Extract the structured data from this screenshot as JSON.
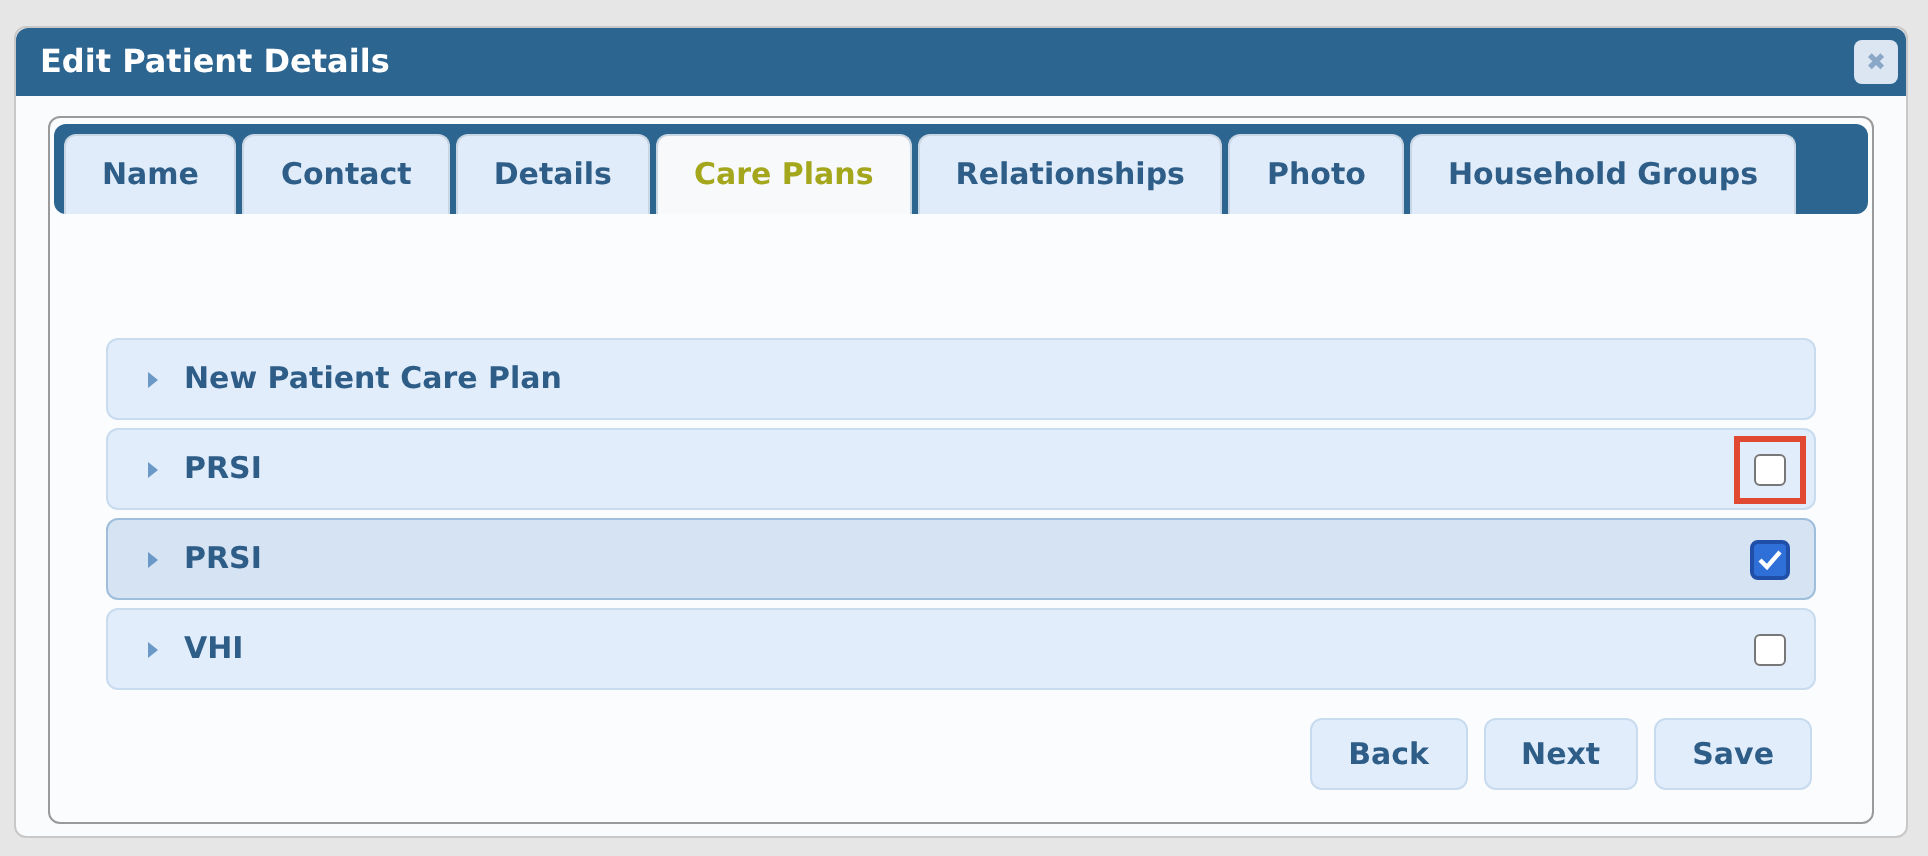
{
  "window": {
    "title": "Edit Patient Details",
    "close": "✖"
  },
  "tabs": [
    {
      "label": "Name",
      "selected": false
    },
    {
      "label": "Contact",
      "selected": false
    },
    {
      "label": "Details",
      "selected": false
    },
    {
      "label": "Care Plans",
      "selected": true
    },
    {
      "label": "Relationships",
      "selected": false
    },
    {
      "label": "Photo",
      "selected": false
    },
    {
      "label": "Household Groups",
      "selected": false
    }
  ],
  "care_plans": [
    {
      "label": "New Patient Care Plan",
      "kind": "header",
      "selected": false
    },
    {
      "label": "PRSI",
      "kind": "checkbox",
      "checked": false,
      "selected": false,
      "highlighted": true
    },
    {
      "label": "PRSI",
      "kind": "checkbox",
      "checked": true,
      "selected": true,
      "highlighted": false
    },
    {
      "label": "VHI",
      "kind": "checkbox",
      "checked": false,
      "selected": false,
      "highlighted": false
    }
  ],
  "buttons": [
    "Back",
    "Next",
    "Save"
  ]
}
